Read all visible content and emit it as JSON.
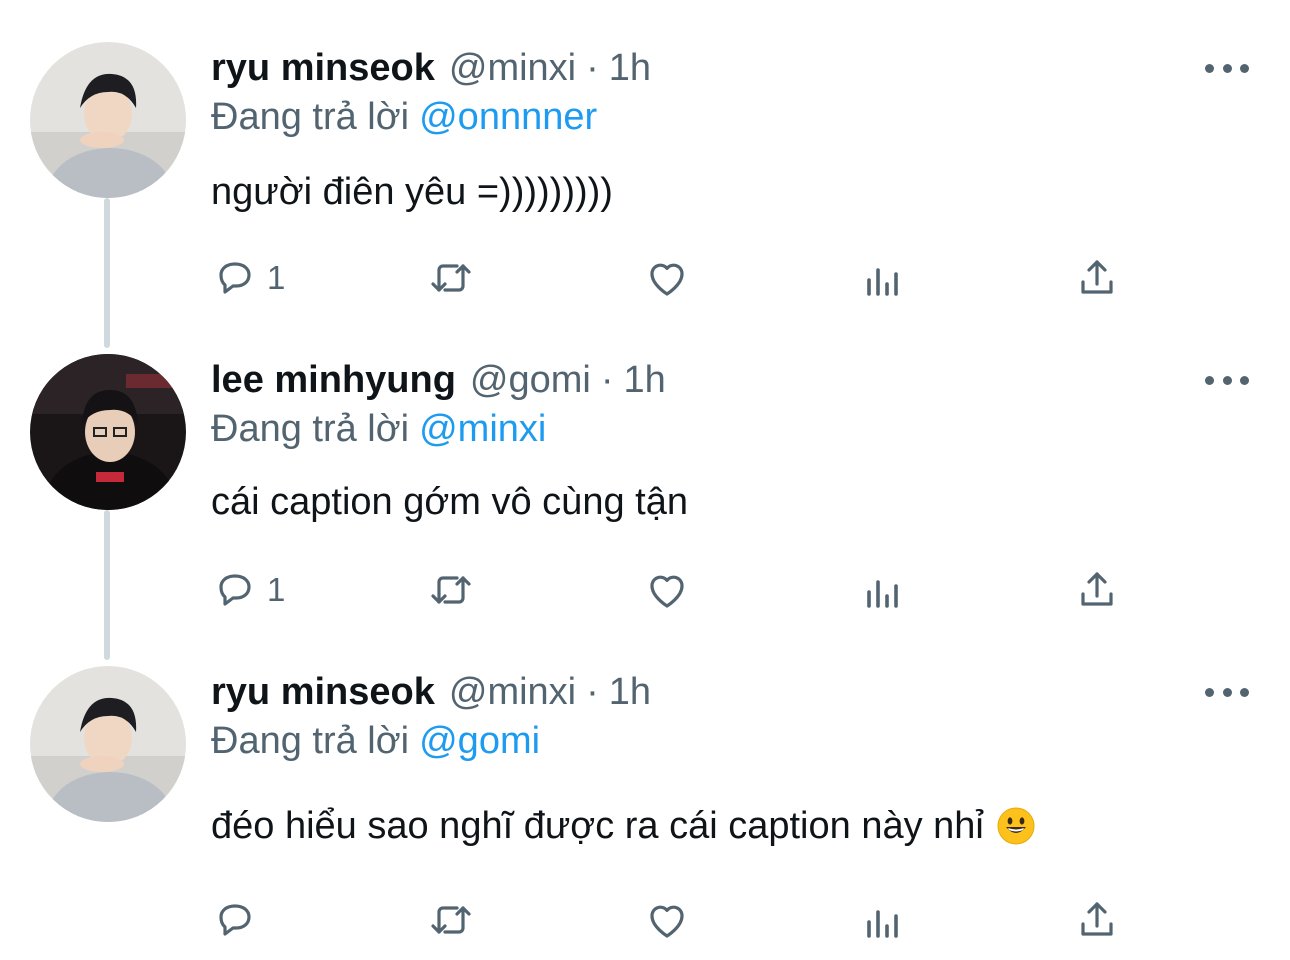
{
  "colors": {
    "name": "#0f1419",
    "meta": "#536471",
    "mention": "#1d9bf0",
    "thread_line": "#cfd9de"
  },
  "tweets": [
    {
      "name": "ryu minseok",
      "handle": "@minxi",
      "separator": "·",
      "time": "1h",
      "replying_prefix": "Đang trả lời",
      "replying_to": "@onnnner",
      "text": "người điên yêu =)))))))))",
      "reply_count": "1",
      "avatar": "avatar-photo-light",
      "emoji": ""
    },
    {
      "name": "lee minhyung",
      "handle": "@gomi",
      "separator": "·",
      "time": "1h",
      "replying_prefix": "Đang trả lời",
      "replying_to": "@minxi",
      "text": "cái caption gớm vô cùng tận",
      "reply_count": "1",
      "avatar": "avatar-photo-dark",
      "emoji": ""
    },
    {
      "name": "ryu minseok",
      "handle": "@minxi",
      "separator": "·",
      "time": "1h",
      "replying_prefix": "Đang trả lời",
      "replying_to": "@gomi",
      "text": "đéo hiểu sao nghĩ được ra cái caption này nhỉ",
      "reply_count": "",
      "avatar": "avatar-photo-light",
      "emoji": "grinning-face-emoji"
    }
  ],
  "icons": {
    "reply": "reply-icon",
    "retweet": "retweet-icon",
    "like": "heart-icon",
    "views": "views-icon",
    "share": "share-icon",
    "more": "more-icon"
  }
}
